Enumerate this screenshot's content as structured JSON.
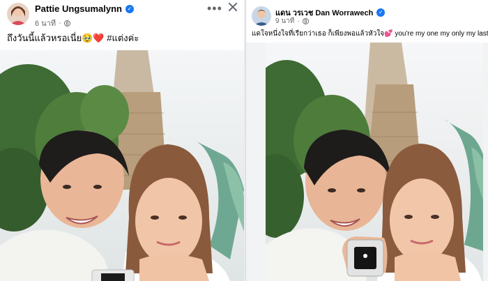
{
  "left_post": {
    "author": "Pattie Ungsumalynn",
    "time": "6 นาที",
    "caption": "ถึงวันนี้แล้วหรอเนี่ย🥹❤️ #แต่งค่ะ",
    "more_label": "•••"
  },
  "right_post": {
    "author": "แดน วรเวช Dan Worrawech",
    "time": "9 นาที",
    "caption": "แดใจหนึ่งใจที่เรียกว่าเธอ ก็เพียงพอแล้วหัวใจ💕 you're my one my only my last.💍"
  },
  "colors": {
    "verified": "#1877f2",
    "secondary_text": "#65676b",
    "primary_text": "#050505",
    "background": "#ffffff"
  },
  "icons": [
    "verified-icon",
    "globe-icon",
    "more-icon",
    "close-icon"
  ]
}
